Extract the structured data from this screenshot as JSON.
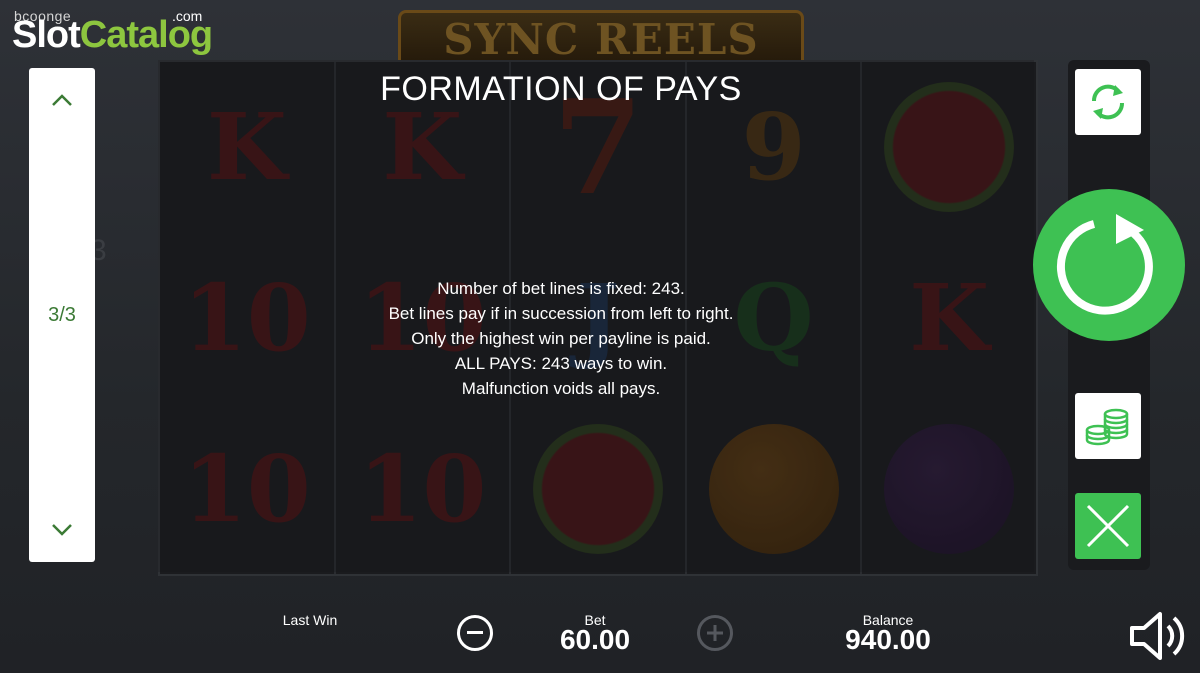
{
  "branding": {
    "provider_small": "bcoonge",
    "site_name_white": "Slot",
    "site_name_green": "Catalog",
    "site_tld": ".com",
    "game_title": "SYNC REELS"
  },
  "pager": {
    "page": "3/3",
    "ghost_page": "3"
  },
  "info": {
    "title": "FORMATION OF PAYS",
    "lines": [
      "Number of bet lines is fixed: 243.",
      "Bet lines pay if in succession from left to right.",
      "Only the highest win per payline is paid.",
      "ALL PAYS: 243 ways to win.",
      "Malfunction voids all pays."
    ]
  },
  "reels": [
    [
      "K",
      "10",
      "10"
    ],
    [
      "K",
      "10",
      "10"
    ],
    [
      "7",
      "J",
      "watermelon"
    ],
    [
      "9",
      "Q",
      "orange"
    ],
    [
      "watermelon",
      "K",
      "plum"
    ]
  ],
  "bottom_bar": {
    "last_win_label": "Last Win",
    "last_win_value": "",
    "bet_label": "Bet",
    "bet_value": "60.00",
    "balance_label": "Balance",
    "balance_value": "940.00"
  },
  "icons": {
    "autoplay": "autoplay-arrows-icon",
    "spin": "spin-arrow-icon",
    "coins": "coins-stack-icon",
    "close": "close-x-icon",
    "sound": "speaker-icon",
    "minus": "minus-circle-icon",
    "plus": "plus-circle-icon",
    "up": "chevron-up-icon",
    "down": "chevron-down-icon"
  },
  "colors": {
    "accent_green": "#3ec153",
    "pager_text": "#3b7a35",
    "background": "#2b2e33"
  }
}
